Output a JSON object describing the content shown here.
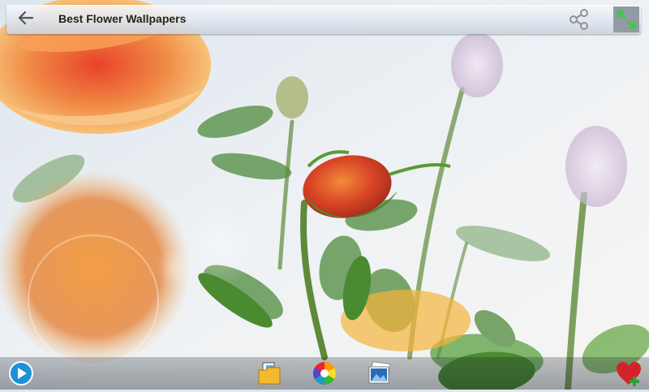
{
  "header": {
    "title": "Best Flower Wallpapers",
    "icons": {
      "back": "back-arrow-icon",
      "share": "share-icon",
      "expand": "expand-icon"
    }
  },
  "wallpaper": {
    "subject": "rose-buds-photo"
  },
  "toolbar": {
    "icons": [
      "slideshow-icon",
      "folder-icon",
      "color-wheel-icon",
      "gallery-icon",
      "favorite-add-icon"
    ]
  },
  "colors": {
    "topbar": "#dfe6ef",
    "accent_green": "#2e9e3a",
    "favorite_red": "#d2232a"
  }
}
